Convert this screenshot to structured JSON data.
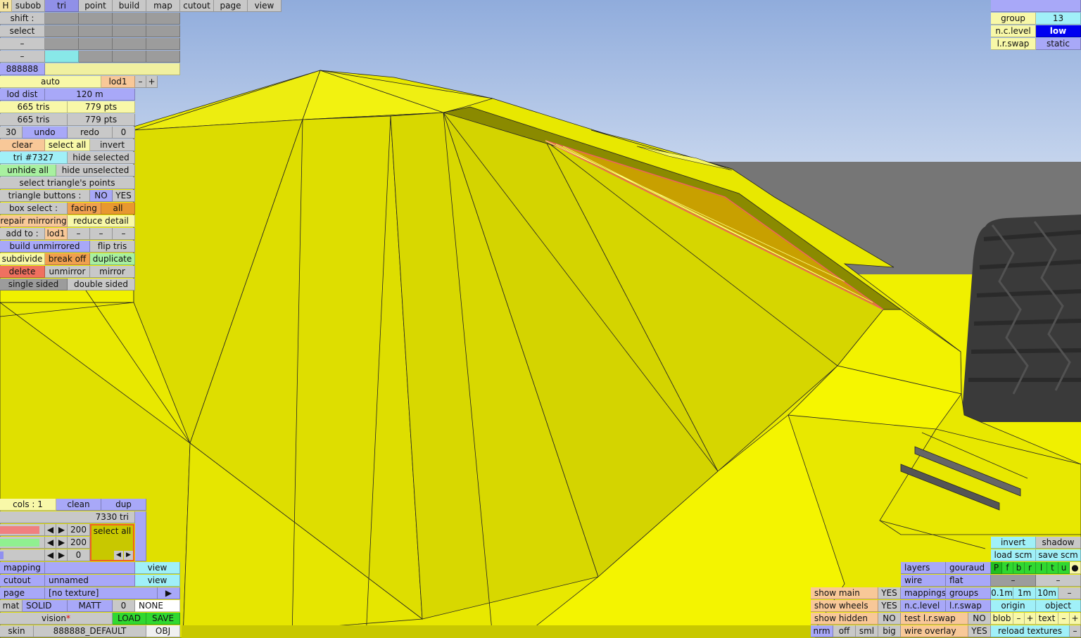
{
  "colors": {
    "sky_top": "#98b4e0",
    "sky_bottom": "#c8d8f0",
    "model_yellow": "#f0f000",
    "road": "#767676"
  },
  "menu": {
    "h": "H",
    "tabs": [
      "subob",
      "tri",
      "point",
      "build",
      "map",
      "cutout",
      "page",
      "view"
    ],
    "active": "tri"
  },
  "left": {
    "shift": "shift :",
    "select": "select",
    "dash1": "–",
    "dash2": "–",
    "color_code": "888888",
    "auto": "auto",
    "lod": "lod1",
    "minus": "–",
    "plus": "+",
    "lod_dist": "lod dist",
    "lod_dist_val": "120 m",
    "tris1": "665 tris",
    "pts1": "779 pts",
    "tris2": "665 tris",
    "pts2": "779 pts",
    "undo_count": "30",
    "undo": "undo",
    "redo": "redo",
    "redo_count": "0",
    "clear": "clear",
    "select_all": "select all",
    "invert": "invert",
    "tri_id": "tri #7327",
    "hide_selected": "hide selected",
    "unhide_all": "unhide all",
    "hide_unselected": "hide unselected",
    "select_points": "select triangle's points",
    "triangle_buttons": "triangle buttons :",
    "no": "NO",
    "yes": "YES",
    "box_select": "box select :",
    "facing": "facing",
    "all": "all",
    "repair_mirroring": "repair mirroring",
    "reduce_detail": "reduce detail",
    "add_to": "add to :",
    "add_lod": "lod1",
    "dash_a": "–",
    "dash_b": "–",
    "dash_c": "–",
    "build_unmirrored": "build unmirrored",
    "flip_tris": "flip tris",
    "subdivide": "subdivide",
    "break_off": "break off",
    "duplicate": "duplicate",
    "delete": "delete",
    "unmirror": "unmirror",
    "mirror": "mirror",
    "single_sided": "single sided",
    "double_sided": "double sided"
  },
  "top_right": {
    "group_label": "group",
    "group_val": "13",
    "ncl_label": "n.c.level",
    "ncl_val": "low",
    "lrs_label": "l.r.swap",
    "lrs_val": "static"
  },
  "bottom_left": {
    "cols": "cols : 1",
    "clean": "clean",
    "dup": "dup",
    "tri_count": "7330 tri",
    "v1": "200",
    "v2": "200",
    "v3": "0",
    "swatch_select_all": "select all",
    "arrow_left": "◀",
    "arrow_right": "▶",
    "mapping": "mapping",
    "view1": "view",
    "cutout": "cutout",
    "cutout_val": "unnamed",
    "view2": "view",
    "page": "page",
    "page_val": "[no texture]",
    "page_arrow": "▶",
    "mat": "mat",
    "solid": "SOLID",
    "matt": "MATT",
    "mat_num": "0",
    "mat_none": "NONE",
    "vision": "vision",
    "vision_star": "*",
    "load": "LOAD",
    "save": "SAVE",
    "skin": "skin",
    "skin_val": "888888_DEFAULT",
    "obj": "OBJ"
  },
  "bottom_right": {
    "invert": "invert",
    "shadow": "shadow",
    "load_scm": "load scm",
    "save_scm": "save scm",
    "flags": [
      "P",
      "f",
      "b",
      "r",
      "l",
      "t",
      "u",
      "●"
    ],
    "layers": "layers",
    "gouraud": "gouraud",
    "wire": "wire",
    "flat": "flat",
    "dash1": "–",
    "dash2": "–",
    "show_main": "show main",
    "show_main_val": "YES",
    "mappings": "mappings",
    "groups": "groups",
    "s01": "0.1m",
    "s1": "1m",
    "s10": "10m",
    "sminus": "–",
    "show_wheels": "show wheels",
    "show_wheels_val": "YES",
    "ncl": "n.c.level",
    "lrs": "l.r.swap",
    "origin": "origin",
    "object": "object",
    "show_hidden": "show hidden",
    "show_hidden_val": "NO",
    "test_lrs": "test l.r.swap",
    "test_lrs_val": "NO",
    "blob": "blob",
    "bm": "–",
    "bp": "+",
    "text": "text",
    "tm": "–",
    "tp": "+",
    "nrm": "nrm",
    "off": "off",
    "sml": "sml",
    "big": "big",
    "wire_overlay": "wire overlay",
    "wire_overlay_val": "YES",
    "reload_textures": "reload textures",
    "rt_minus": "–"
  }
}
